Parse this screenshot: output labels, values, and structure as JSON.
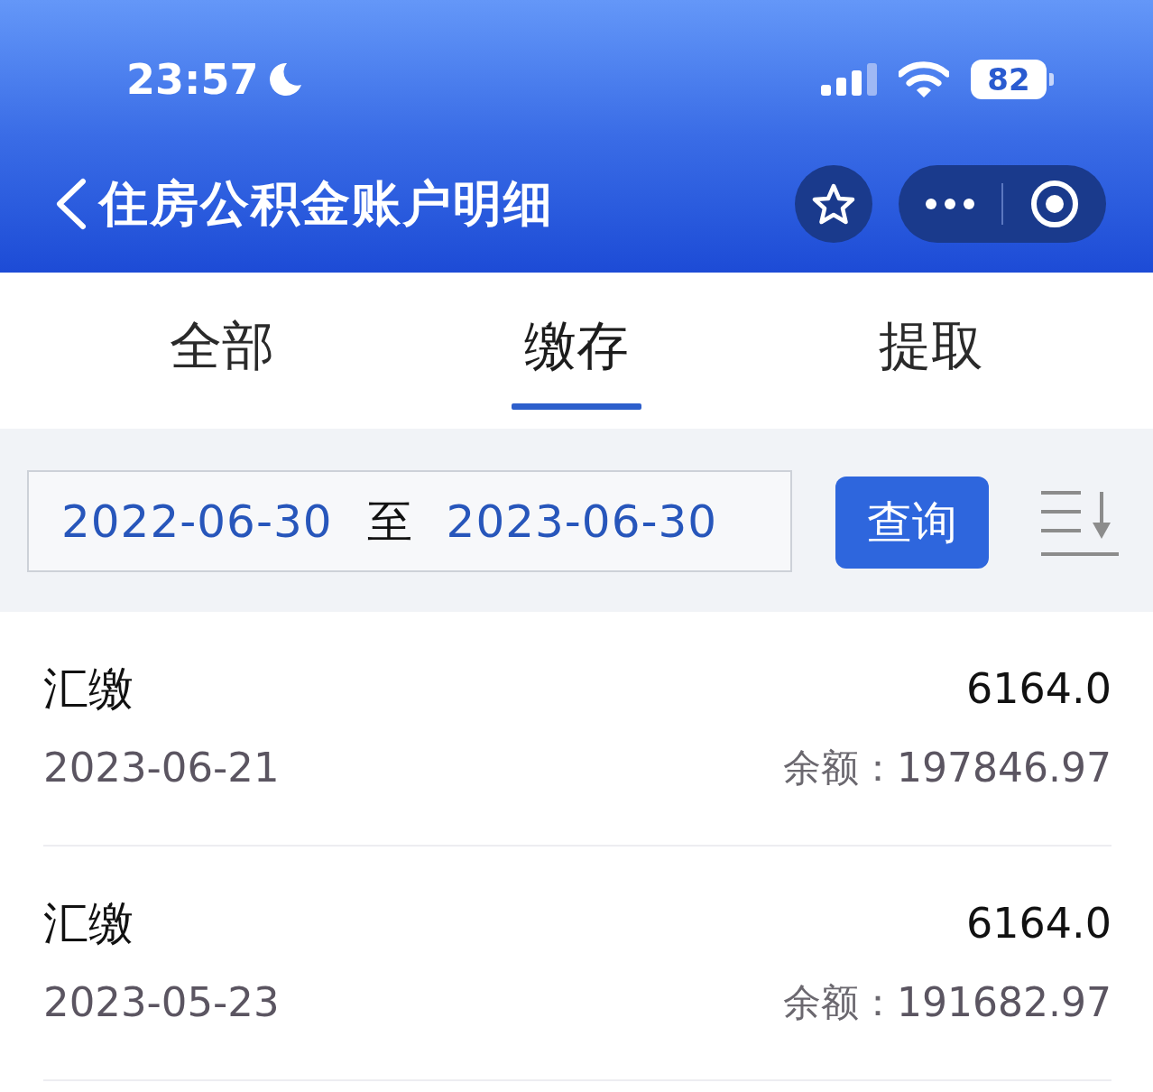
{
  "status_bar": {
    "time": "23:57",
    "battery": "82"
  },
  "nav": {
    "title": "住房公积金账户明细"
  },
  "tabs": [
    {
      "label": "全部",
      "selected": false
    },
    {
      "label": "缴存",
      "selected": true
    },
    {
      "label": "提取",
      "selected": false
    }
  ],
  "filter": {
    "start_date": "2022-06-30",
    "separator": "至",
    "end_date": "2023-06-30",
    "query_button": "查询"
  },
  "records": [
    {
      "type": "汇缴",
      "amount": "6164.0",
      "date": "2023-06-21",
      "balance_label": "余额：",
      "balance": "197846.97"
    },
    {
      "type": "汇缴",
      "amount": "6164.0",
      "date": "2023-05-23",
      "balance_label": "余额：",
      "balance": "191682.97"
    }
  ]
}
